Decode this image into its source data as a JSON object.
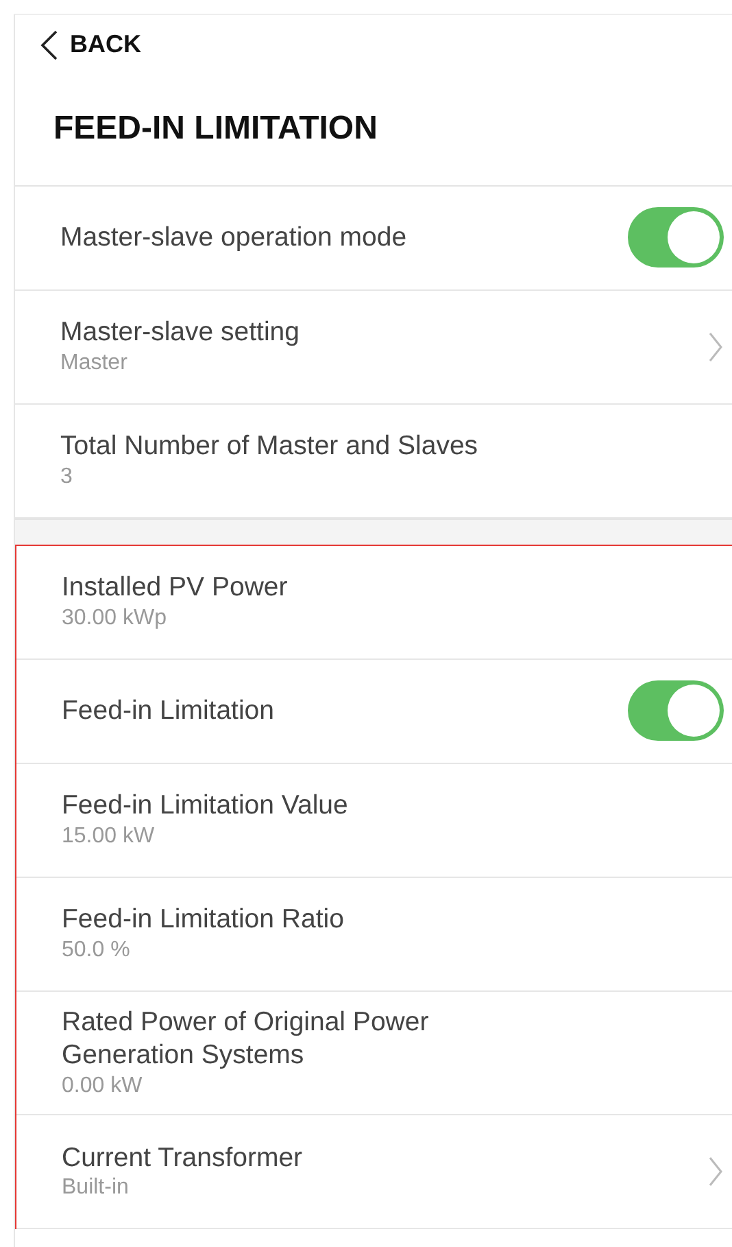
{
  "back": {
    "label": "BACK"
  },
  "title": "FEED-IN LIMITATION",
  "groups": [
    {
      "highlighted": false,
      "rows": [
        {
          "kind": "toggle",
          "label": "Master-slave operation mode",
          "on": true
        },
        {
          "kind": "link",
          "label": "Master-slave setting",
          "value": "Master"
        },
        {
          "kind": "value",
          "label": "Total Number of Master and Slaves",
          "value": "3"
        }
      ]
    },
    {
      "highlighted": true,
      "rows": [
        {
          "kind": "value",
          "label": "Installed PV Power",
          "value": "30.00 kWp"
        },
        {
          "kind": "toggle",
          "label": "Feed-in Limitation",
          "on": true
        },
        {
          "kind": "value",
          "label": "Feed-in Limitation Value",
          "value": "15.00 kW"
        },
        {
          "kind": "value",
          "label": "Feed-in Limitation Ratio",
          "value": "50.0 %"
        },
        {
          "kind": "value",
          "label": "Rated Power of Original Power Generation Systems",
          "value": "0.00 kW"
        },
        {
          "kind": "link",
          "label": "Current Transformer",
          "value": "Built-in"
        }
      ]
    }
  ]
}
